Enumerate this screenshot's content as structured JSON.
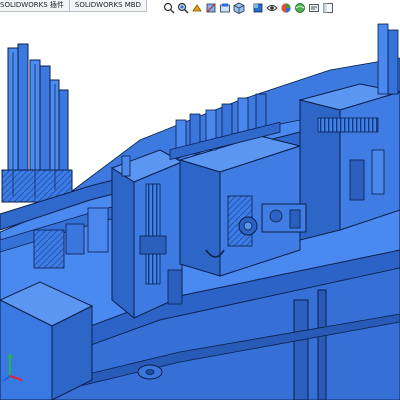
{
  "window": {
    "app": "SOLIDWORKS"
  },
  "tabs": [
    {
      "label": "SOLIDWORKS 插件"
    },
    {
      "label": "SOLIDWORKS MBD"
    }
  ],
  "heads_up_toolbar": {
    "tools": [
      {
        "name": "zoom-to-fit"
      },
      {
        "name": "zoom-to-area"
      },
      {
        "name": "previous-view"
      },
      {
        "name": "section-view"
      },
      {
        "name": "dynamic-annotation-views"
      },
      {
        "name": "view-orientation"
      },
      {
        "name": "display-style"
      },
      {
        "name": "hide-show-items"
      },
      {
        "name": "edit-appearance"
      },
      {
        "name": "apply-scene"
      },
      {
        "name": "view-settings"
      },
      {
        "name": "display-pane"
      }
    ]
  },
  "viewport": {
    "content": "3d-assembly-model",
    "model_color": "#3f7fe6",
    "edge_color": "#0b1f4a",
    "background": "#ffffff"
  },
  "triad": {
    "axes": [
      "x",
      "y",
      "z"
    ],
    "colors": {
      "x": "#e0262a",
      "y": "#26b34a",
      "z": "#2a5fe0"
    }
  }
}
